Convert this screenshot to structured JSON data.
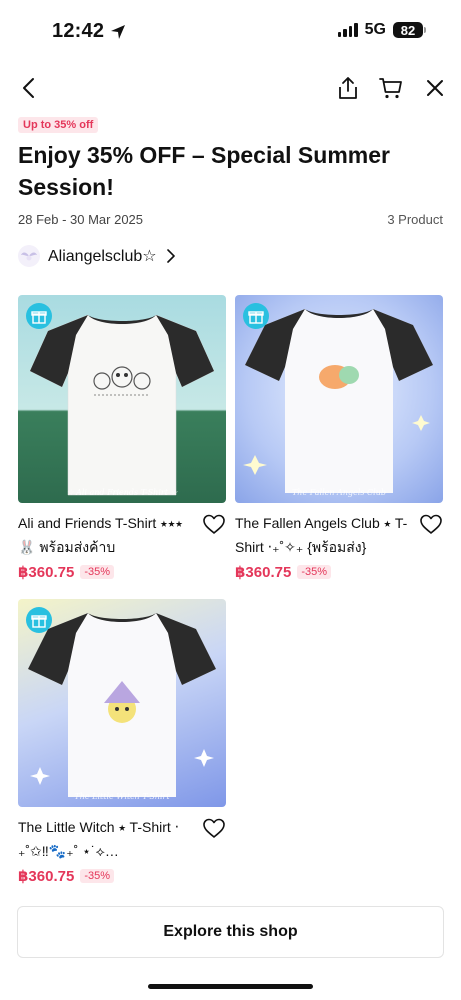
{
  "status": {
    "time": "12:42",
    "network": "5G",
    "battery": "82"
  },
  "nav": {
    "back_icon": "chevron-left-icon",
    "share_icon": "share-icon",
    "cart_icon": "cart-icon",
    "close_icon": "close-icon"
  },
  "header": {
    "badge": "Up to 35% off",
    "title": "Enjoy 35% OFF – Special Summer Session!",
    "dates": "28 Feb - 30 Mar 2025",
    "product_count": "3 Product",
    "shop_name": "Aliangelsclub☆"
  },
  "products": [
    {
      "name": "Ali and Friends T-Shirt ⭑⭑⭑ 🐰 พร้อมส่งค้าบ",
      "price": "฿360.75",
      "discount": "-35%",
      "watermark": "☆ Ali and Friends T-Shirt ☆"
    },
    {
      "name": "The Fallen Angels Club ⭑ T-Shirt ‧₊˚✧₊ {พร้อมส่ง}",
      "price": "฿360.75",
      "discount": "-35%",
      "watermark": "The Fallen Angels Club"
    },
    {
      "name": "The Little Witch ⭑ T-Shirt ‧₊˚✩‼🐾₊˚ ⋆˙⟡…",
      "price": "฿360.75",
      "discount": "-35%",
      "watermark": "The Little Witch T-Shirt"
    }
  ],
  "explore_label": "Explore this shop",
  "colors": {
    "accent": "#e4375a",
    "badge_bg": "#fde6ea",
    "gift": "#29c0e0"
  }
}
